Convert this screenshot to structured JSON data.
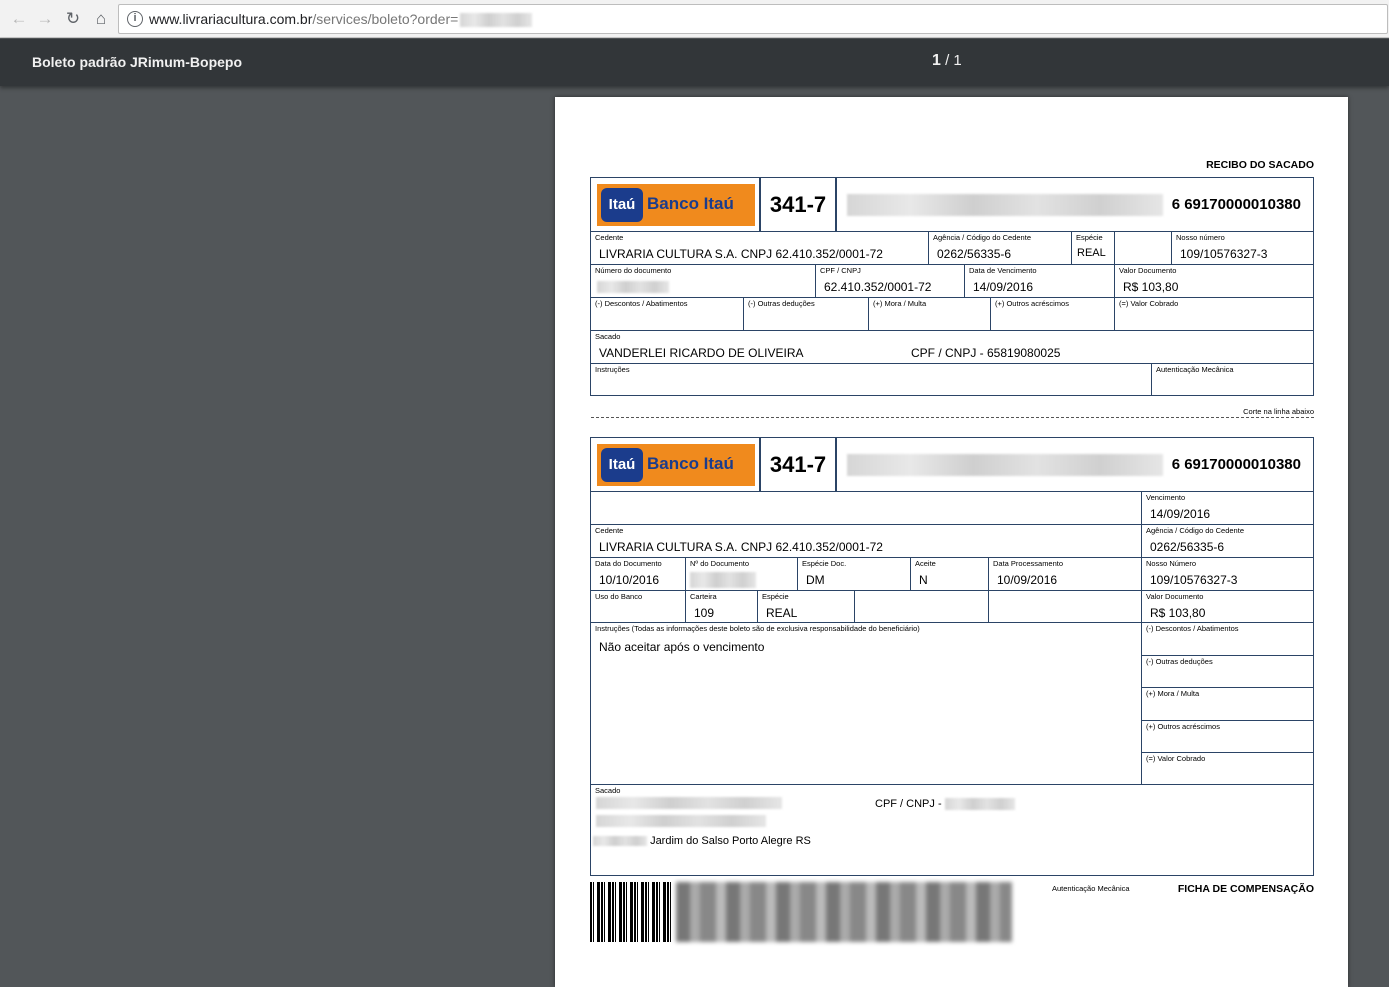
{
  "browser": {
    "url_host": "www.livrariacultura.com.br",
    "url_path": "/services/boleto?order="
  },
  "pdf": {
    "title": "Boleto padrão JRimum-Bopepo",
    "page_current": "1",
    "page_separator": "/",
    "page_total": "1"
  },
  "recibo": {
    "heading": "RECIBO DO SACADO",
    "bank_name": "Banco Itaú",
    "bank_logo_text": "Itaú",
    "bank_code": "341-7",
    "linha_digitavel_tail": "6 69170000010380",
    "cedente_label": "Cedente",
    "cedente_value": "LIVRARIA CULTURA S.A. CNPJ 62.410.352/0001-72",
    "agencia_label": "Agência / Código do Cedente",
    "agencia_value": "0262/56335-6",
    "especie_label": "Espécie",
    "especie_value": "REAL",
    "nosso_label": "Nosso número",
    "nosso_value": "109/10576327-3",
    "numdoc_label": "Número do documento",
    "cpf_label": "CPF / CNPJ",
    "cpf_value": "62.410.352/0001-72",
    "venc_label": "Data de Vencimento",
    "venc_value": "14/09/2016",
    "valor_label": "Valor Documento",
    "valor_value": "R$ 103,80",
    "desc_label": "(-) Descontos / Abatimentos",
    "outras_label": "(-) Outras deduções",
    "mora_label": "(+) Mora / Multa",
    "acresc_label": "(+) Outros acréscimos",
    "cobrado_label": "(=) Valor Cobrado",
    "sacado_label": "Sacado",
    "sacado_value": "VANDERLEI RICARDO DE OLIVEIRA",
    "sacado_cpf": "CPF / CNPJ - 65819080025",
    "instr_label": "Instruções",
    "autent_label": "Autenticação Mecânica",
    "corte_label": "Corte na linha abaixo"
  },
  "ficha": {
    "heading": "FICHA DE COMPENSAÇÃO",
    "autent_label": "Autenticação Mecânica",
    "bank_name": "Banco Itaú",
    "bank_logo_text": "Itaú",
    "bank_code": "341-7",
    "linha_digitavel_tail": "6 69170000010380",
    "venc_label": "Vencimento",
    "venc_value": "14/09/2016",
    "cedente_label": "Cedente",
    "cedente_value": "LIVRARIA CULTURA S.A. CNPJ 62.410.352/0001-72",
    "agencia_label": "Agência / Código do Cedente",
    "agencia_value": "0262/56335-6",
    "datadoc_label": "Data do Documento",
    "datadoc_value": "10/10/2016",
    "ndoc_label": "Nº do Documento",
    "espdoc_label": "Espécie Doc.",
    "espdoc_value": "DM",
    "aceite_label": "Aceite",
    "aceite_value": "N",
    "dataproc_label": "Data Processamento",
    "dataproc_value": "10/09/2016",
    "nosso_label": "Nosso Número",
    "nosso_value": "109/10576327-3",
    "usobanco_label": "Uso do Banco",
    "carteira_label": "Carteira",
    "carteira_value": "109",
    "especie_label": "Espécie",
    "especie_value": "REAL",
    "valor_label": "Valor Documento",
    "valor_value": "R$ 103,80",
    "instr_label": "Instruções (Todas as informações deste boleto são de exclusiva responsabilidade do beneficiário)",
    "instr_value": "Não aceitar após o vencimento",
    "desc_label": "(-) Descontos / Abatimentos",
    "outras_label": "(-) Outras deduções",
    "mora_label": "(+) Mora / Multa",
    "acresc_label": "(+) Outros acréscimos",
    "cobrado_label": "(=) Valor Cobrado",
    "sacado_label": "Sacado",
    "sacado_cpf_label": "CPF / CNPJ -",
    "sacado_address_tail": "Jardim do Salso Porto Alegre RS"
  }
}
